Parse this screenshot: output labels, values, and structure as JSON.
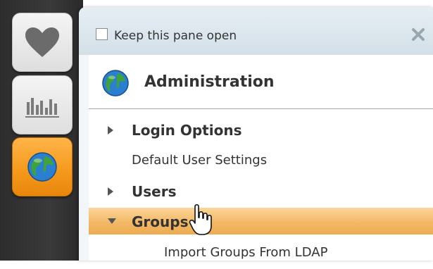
{
  "rail": {
    "buttons": [
      {
        "icon": "heart-icon",
        "active": false
      },
      {
        "icon": "bar-chart-icon",
        "active": false
      },
      {
        "icon": "globe-icon",
        "active": true
      }
    ]
  },
  "pane": {
    "keep_open_label": "Keep this pane open",
    "keep_open_checked": false,
    "section_title": "Administration",
    "items": [
      {
        "label": "Login Options",
        "expandable": true,
        "expanded": false,
        "selected": false
      },
      {
        "label": "Default User Settings",
        "expandable": false,
        "selected": false
      },
      {
        "label": "Users",
        "expandable": true,
        "expanded": false,
        "selected": false
      },
      {
        "label": "Groups",
        "expandable": true,
        "expanded": true,
        "selected": true
      },
      {
        "label": "Import Groups From LDAP",
        "expandable": false,
        "selected": false,
        "child_of": "Groups"
      }
    ]
  },
  "colors": {
    "selected_row": "#f3b865",
    "active_rail_button": "#f59a1d",
    "rail_background": "#333333"
  }
}
